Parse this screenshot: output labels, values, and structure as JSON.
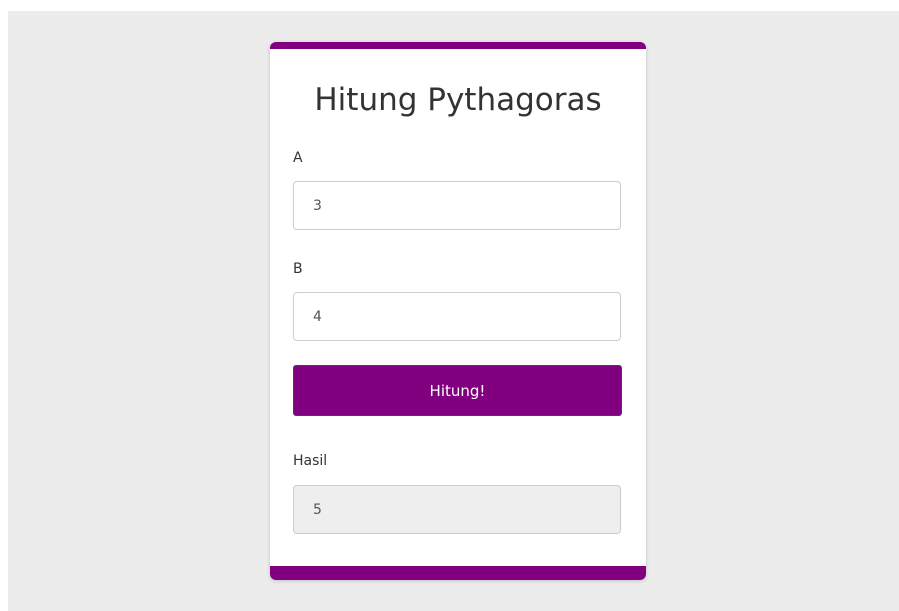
{
  "form": {
    "title": "Hitung Pythagoras",
    "field_a": {
      "label": "A",
      "value": "3"
    },
    "field_b": {
      "label": "B",
      "value": "4"
    },
    "submit_label": "Hitung!",
    "result": {
      "label": "Hasil",
      "value": "5"
    }
  },
  "theme": {
    "accent": "#800080",
    "page_background": "#ececec",
    "card_background": "#ffffff",
    "readonly_background": "#eeeeee"
  }
}
